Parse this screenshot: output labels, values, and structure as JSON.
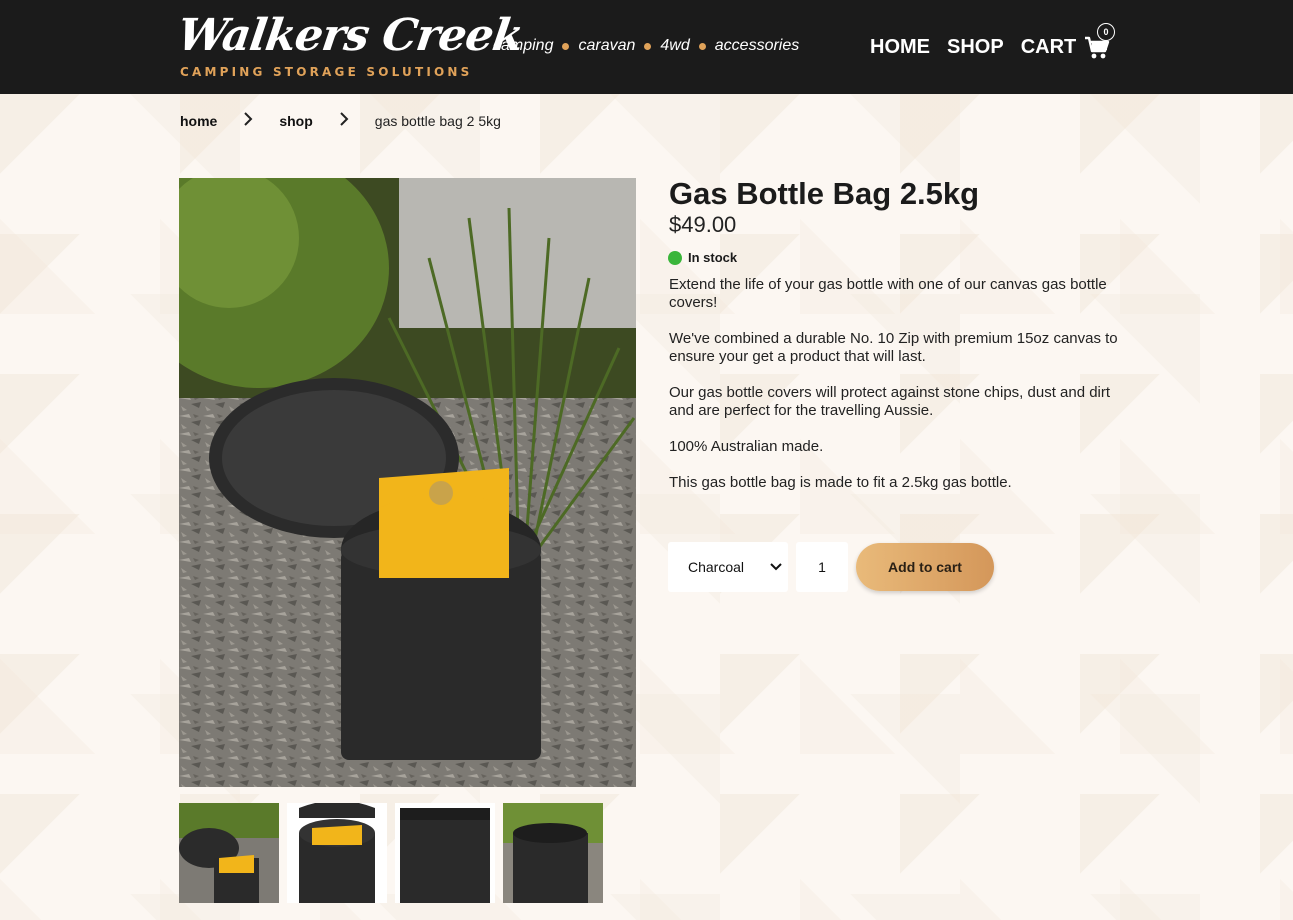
{
  "header": {
    "logo": {
      "name": "Walkers Creek",
      "tagline": "CAMPING STORAGE SOLUTIONS"
    },
    "categories": [
      "camping",
      "caravan",
      "4wd",
      "accessories"
    ],
    "nav": {
      "home": "HOME",
      "shop": "SHOP",
      "cart": "CART",
      "cart_count": "0"
    }
  },
  "breadcrumb": {
    "home": "home",
    "shop": "shop",
    "current": "gas bottle bag 2 5kg"
  },
  "product": {
    "title": "Gas Bottle Bag 2.5kg",
    "price": "$49.00",
    "stock": "In stock",
    "description": [
      "Extend the life of your gas bottle with one of our canvas gas bottle covers!",
      "We've combined a durable No. 10 Zip with premium 15oz canvas to ensure your get a product that will last.",
      "Our gas bottle covers will protect against stone chips, dust and dirt and are perfect for the travelling Aussie.",
      "100% Australian made.",
      "This gas bottle bag is made to fit a 2.5kg gas bottle."
    ],
    "color_option": "Charcoal",
    "quantity": "1",
    "add_to_cart": "Add to cart"
  },
  "colors": {
    "header_bg": "#1b1b1b",
    "accent": "#e0a259",
    "stock_green": "#3ab53a",
    "bag_black": "#2a2a2a",
    "bottle_yellow": "#f2b51a"
  }
}
